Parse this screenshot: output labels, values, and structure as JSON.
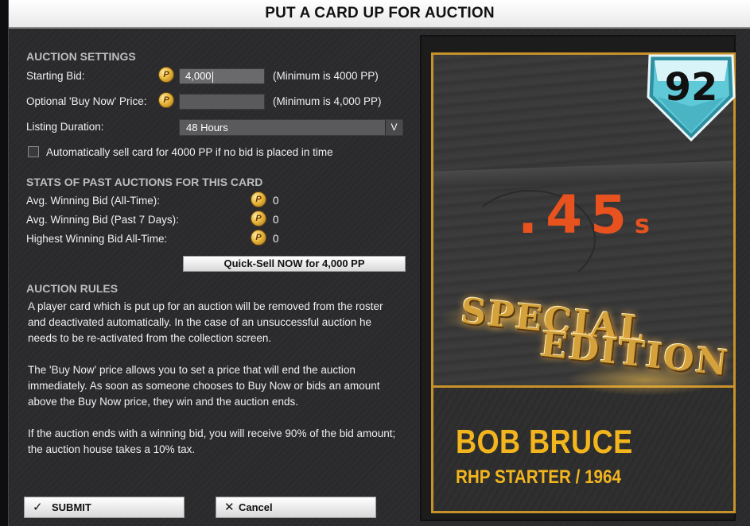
{
  "dialog": {
    "title": "PUT A CARD UP FOR AUCTION"
  },
  "auction_settings": {
    "heading": "AUCTION SETTINGS",
    "starting_bid_label": "Starting Bid:",
    "starting_bid_value": "4,000",
    "starting_bid_hint": "(Minimum is 4000 PP)",
    "buy_now_label": "Optional 'Buy Now' Price:",
    "buy_now_value": "",
    "buy_now_hint": "(Minimum is 4,000 PP)",
    "duration_label": "Listing Duration:",
    "duration_value": "48 Hours",
    "duration_arrow": "V",
    "autosell_label": "Automatically sell card for 4000 PP if no bid is placed in time",
    "autosell_checked": false
  },
  "stats": {
    "heading": "STATS OF PAST AUCTIONS FOR THIS CARD",
    "rows": [
      {
        "label": "Avg. Winning Bid (All-Time):",
        "value": "0"
      },
      {
        "label": "Avg. Winning Bid (Past 7 Days):",
        "value": "0"
      },
      {
        "label": "Highest Winning Bid All-Time:",
        "value": "0"
      }
    ],
    "quicksell_label": "Quick-Sell NOW for 4,000 PP"
  },
  "rules": {
    "heading": "AUCTION RULES",
    "paragraphs": [
      "A player card which is put up for an auction will be removed from the roster and deactivated automatically. In the case of an unsuccessful auction he needs to be re-activated from the collection screen.",
      "The 'Buy Now' price allows you to set a price that will end the auction immediately. As soon as someone chooses to Buy Now or bids an amount above the Buy Now price, they win and the auction ends.",
      "If the auction ends with a winning bid, you will receive 90% of the bid amount; the auction house takes a 10% tax."
    ]
  },
  "buttons": {
    "submit_label": "SUBMIT",
    "submit_icon": "✓",
    "cancel_label": "Cancel",
    "cancel_icon": "✕"
  },
  "card": {
    "rating": "92",
    "team_logo_text": ".45",
    "team_logo_suffix": "s",
    "edition_line1": "SPECIAL",
    "edition_line2": "EDITION",
    "player_name": "BOB BRUCE",
    "player_meta": "RHP STARTER / 1964"
  },
  "coin_symbol": "P",
  "colors": {
    "accent_gold": "#f2b51e",
    "badge_teal": "#5fc9d8",
    "logo_orange": "#e8521e"
  }
}
